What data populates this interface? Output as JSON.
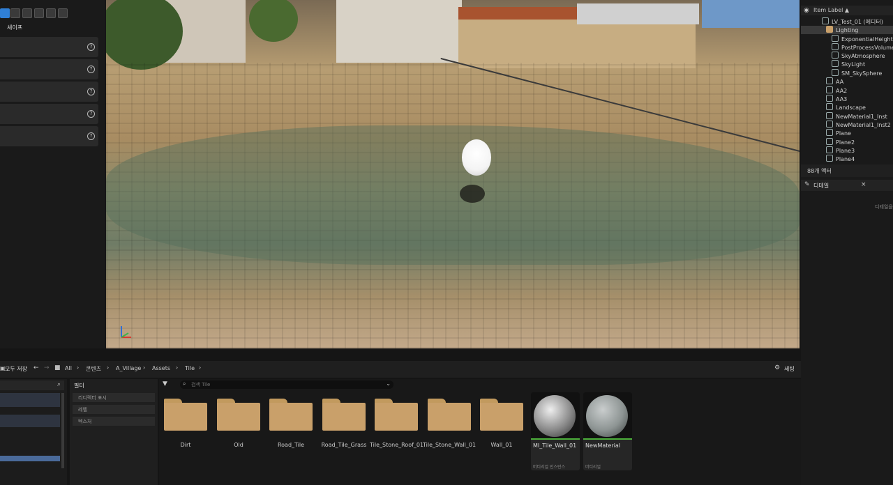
{
  "left_panel": {
    "shape_label": "셰이프",
    "categories": [
      {
        "label": ""
      },
      {
        "label": ""
      },
      {
        "label": ""
      },
      {
        "label": ""
      },
      {
        "label": ""
      }
    ]
  },
  "outliner": {
    "header": "Item Label ▲",
    "items": [
      {
        "label": "LV_Test_01 (에디터)"
      },
      {
        "label": "Lighting"
      },
      {
        "label": "ExponentialHeightFog"
      },
      {
        "label": "PostProcessVolume"
      },
      {
        "label": "SkyAtmosphere"
      },
      {
        "label": "SkyLight"
      },
      {
        "label": "SM_SkySphere"
      },
      {
        "label": "AA"
      },
      {
        "label": "AA2"
      },
      {
        "label": "AA3"
      },
      {
        "label": "Landscape"
      },
      {
        "label": "NewMaterial1_Inst"
      },
      {
        "label": "NewMaterial1_Inst2"
      },
      {
        "label": "Plane"
      },
      {
        "label": "Plane2"
      },
      {
        "label": "Plane3"
      },
      {
        "label": "Plane4"
      }
    ],
    "actor_count": "88개 액터"
  },
  "details": {
    "tab_label": "디테일",
    "close": "×",
    "hint": "디테일을"
  },
  "content_browser": {
    "save_all": "모두 저장",
    "breadcrumb": [
      "All",
      "콘텐츠",
      "A_Village",
      "Assets",
      "Tile"
    ],
    "settings": "세팅",
    "filters_title": "필터",
    "filters": [
      "리디렉터 표시",
      "레벨",
      "텍스처"
    ],
    "search_placeholder": "검색 Tile",
    "folders": [
      "Dirt",
      "Old",
      "Road_Tile",
      "Road_Tile_Grass",
      "Tile_Stone_Roof_01",
      "Tile_Stone_Wall_01",
      "Wall_01"
    ],
    "assets": [
      {
        "name": "MI_Tile_Wall_01",
        "type": "머티리얼 인스턴스"
      },
      {
        "name": "NewMaterial",
        "type": "머티리얼"
      }
    ]
  },
  "colors": {
    "accent": "#2f7fd6",
    "folder": "#c9a06a",
    "material_bar": "#4caf3a"
  }
}
